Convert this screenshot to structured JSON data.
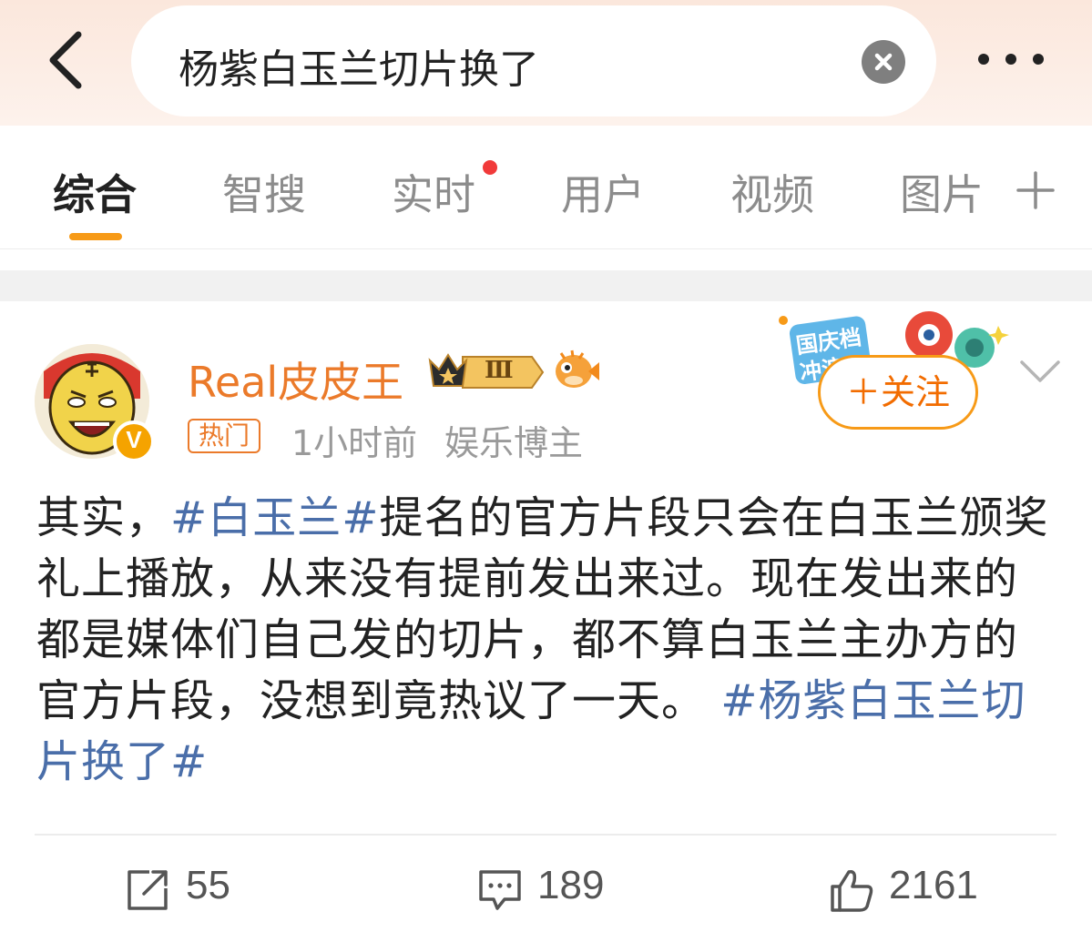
{
  "header": {
    "search_query": "杨紫白玉兰切片换了",
    "icons": {
      "back": "chevron-left-icon",
      "clear": "close-circle-icon",
      "more": "more-dots-icon"
    }
  },
  "tabs": {
    "items": [
      "综合",
      "智搜",
      "实时",
      "用户",
      "视频",
      "图片"
    ],
    "active": "综合",
    "accent_color": "#f79a17",
    "notification_dot_on": "实时",
    "add_icon": "plus-icon"
  },
  "post": {
    "username": "Real皮皮王",
    "level_badge": "Ⅲ",
    "hot_tag": "热门",
    "time": "1小时前",
    "source": "娱乐博主",
    "promo_text": "国庆档冲浪",
    "follow_label": "＋关注",
    "text_segments": [
      {
        "text": "其实，",
        "topic": false
      },
      {
        "text": "#白玉兰#",
        "topic": true
      },
      {
        "text": "提名的官方片段只会在白玉兰颁奖礼上播放，从来没有提前发出来过。现在发出来的都是媒体们自己发的切片，都不算白玉兰主办方的官方片段，没想到竟热议了一天。 ",
        "topic": false
      },
      {
        "text": "#杨紫白玉兰切片换了#",
        "topic": true
      }
    ],
    "actions": {
      "repost_count": "55",
      "comment_count": "189",
      "like_count": "2161"
    },
    "username_color": "#eb7a2a",
    "topic_color": "#4a6ea9"
  }
}
